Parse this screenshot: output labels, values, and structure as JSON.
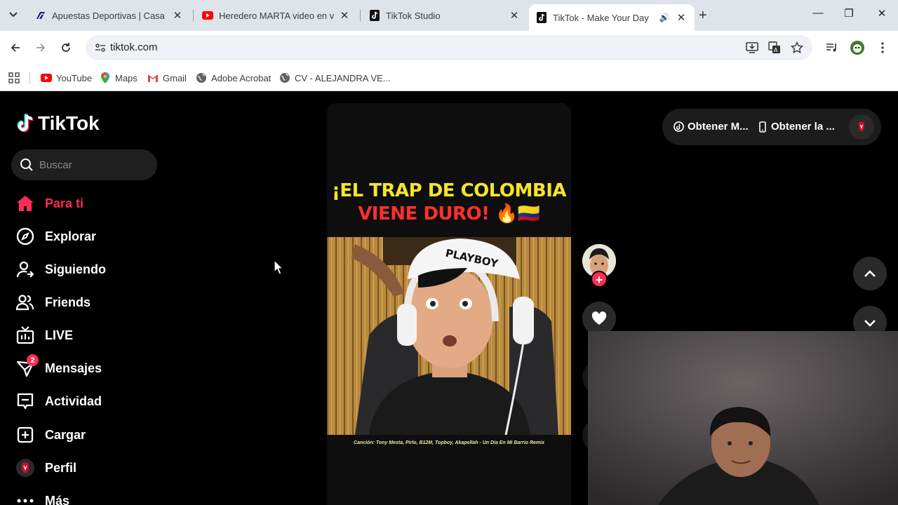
{
  "browser": {
    "tabs": [
      {
        "title": "Apuestas Deportivas | Casa de Apuestas",
        "icon": "rushbet-icon"
      },
      {
        "title": "Heredero MARTA video en vivo",
        "icon": "youtube-icon"
      },
      {
        "title": "TikTok Studio",
        "icon": "tiktok-icon"
      },
      {
        "title": "TikTok - Make Your Day",
        "icon": "tiktok-icon",
        "active": true
      }
    ],
    "url": "tiktok.com",
    "bookmarks": [
      {
        "label": "YouTube",
        "icon": "youtube-icon"
      },
      {
        "label": "Maps",
        "icon": "maps-pin-icon"
      },
      {
        "label": "Gmail",
        "icon": "gmail-icon"
      },
      {
        "label": "Adobe Acrobat",
        "icon": "globe-icon"
      },
      {
        "label": "CV - ALEJANDRA VE...",
        "icon": "globe-icon"
      }
    ]
  },
  "tiktok": {
    "logo_text": "TikTok",
    "search_placeholder": "Buscar",
    "nav": [
      {
        "label": "Para ti",
        "icon": "home-icon",
        "active": true
      },
      {
        "label": "Explorar",
        "icon": "compass-icon"
      },
      {
        "label": "Siguiendo",
        "icon": "following-icon"
      },
      {
        "label": "Friends",
        "icon": "friends-icon"
      },
      {
        "label": "LIVE",
        "icon": "live-tv-icon"
      },
      {
        "label": "Mensajes",
        "icon": "messages-icon",
        "badge": "2"
      },
      {
        "label": "Actividad",
        "icon": "activity-icon"
      },
      {
        "label": "Cargar",
        "icon": "upload-icon"
      },
      {
        "label": "Perfil",
        "icon": "profile-icon"
      },
      {
        "label": "Más",
        "icon": "more-dots-icon"
      }
    ],
    "video": {
      "caption_line1": "¡EL TRAP DE COLOMBIA",
      "caption_line2": "VIENE DURO! 🔥🇨🇴",
      "cap_text": "PLAYBOY",
      "credit": "Canción: Tony Mesta, Pirlo, B12M, Topboy, Akapellah - Un Día En Mi Barrio Remix"
    },
    "top_right": {
      "item1": "Obtener M...",
      "item2": "Obtener la ..."
    },
    "colors": {
      "accent": "#fe2c55",
      "caption_yellow": "#f6e52a",
      "caption_red": "#ff2f2f"
    }
  }
}
